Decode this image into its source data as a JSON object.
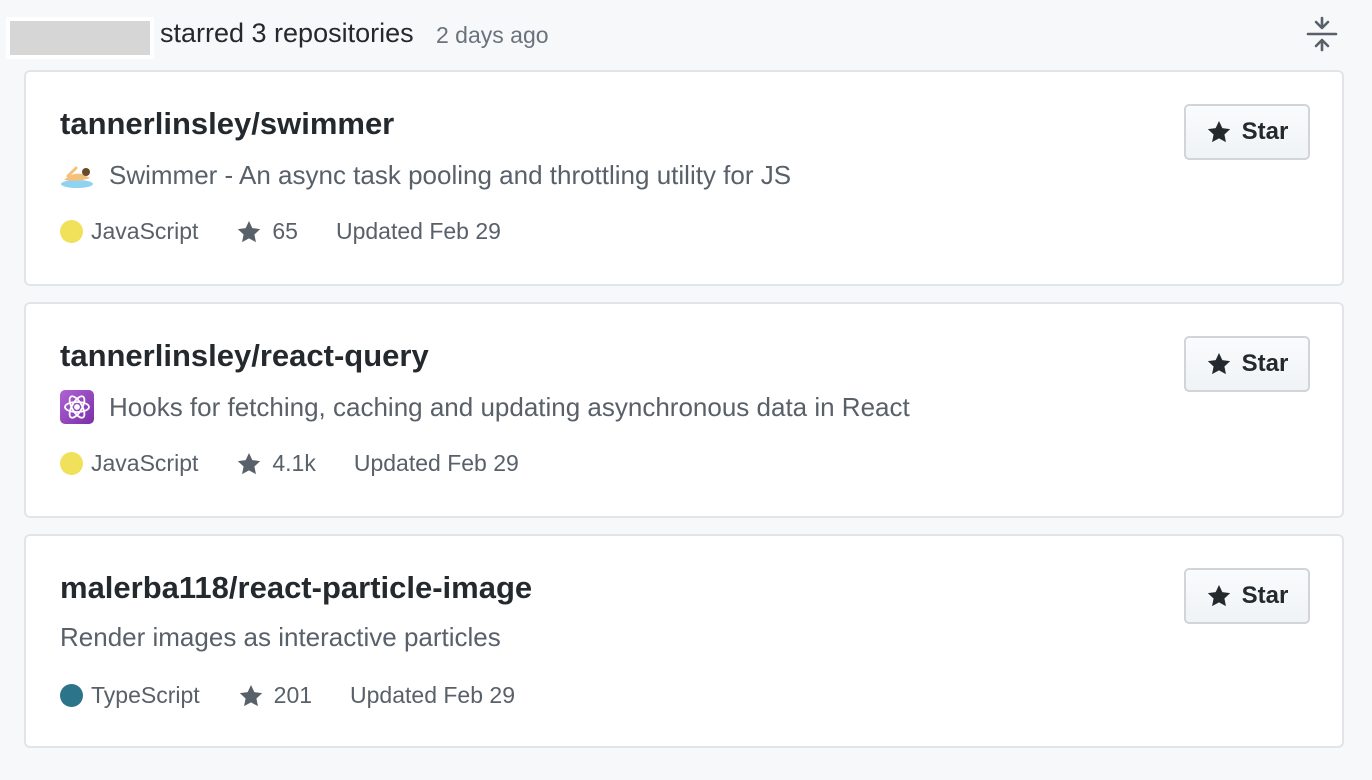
{
  "header": {
    "action_text": "starred 3 repositories",
    "time_text": "2 days ago",
    "collapse_icon": "fold-icon"
  },
  "colors": {
    "javascript": "#f1e05a",
    "typescript": "#2b7489",
    "text_primary": "#24292e",
    "text_secondary": "#586069"
  },
  "repos": [
    {
      "name": "tannerlinsley/swimmer",
      "emoji_icon": "swimmer-emoji-icon",
      "description": "Swimmer - An async task pooling and throttling utility for JS",
      "language": "JavaScript",
      "language_color": "#f1e05a",
      "stars": "65",
      "updated": "Updated Feb 29",
      "star_button_label": "Star"
    },
    {
      "name": "tannerlinsley/react-query",
      "emoji_icon": "atom-emoji-icon",
      "description": "Hooks for fetching, caching and updating asynchronous data in React",
      "language": "JavaScript",
      "language_color": "#f1e05a",
      "stars": "4.1k",
      "updated": "Updated Feb 29",
      "star_button_label": "Star"
    },
    {
      "name": "malerba118/react-particle-image",
      "description": "Render images as interactive particles",
      "language": "TypeScript",
      "language_color": "#2b7489",
      "stars": "201",
      "updated": "Updated Feb 29",
      "star_button_label": "Star"
    }
  ]
}
